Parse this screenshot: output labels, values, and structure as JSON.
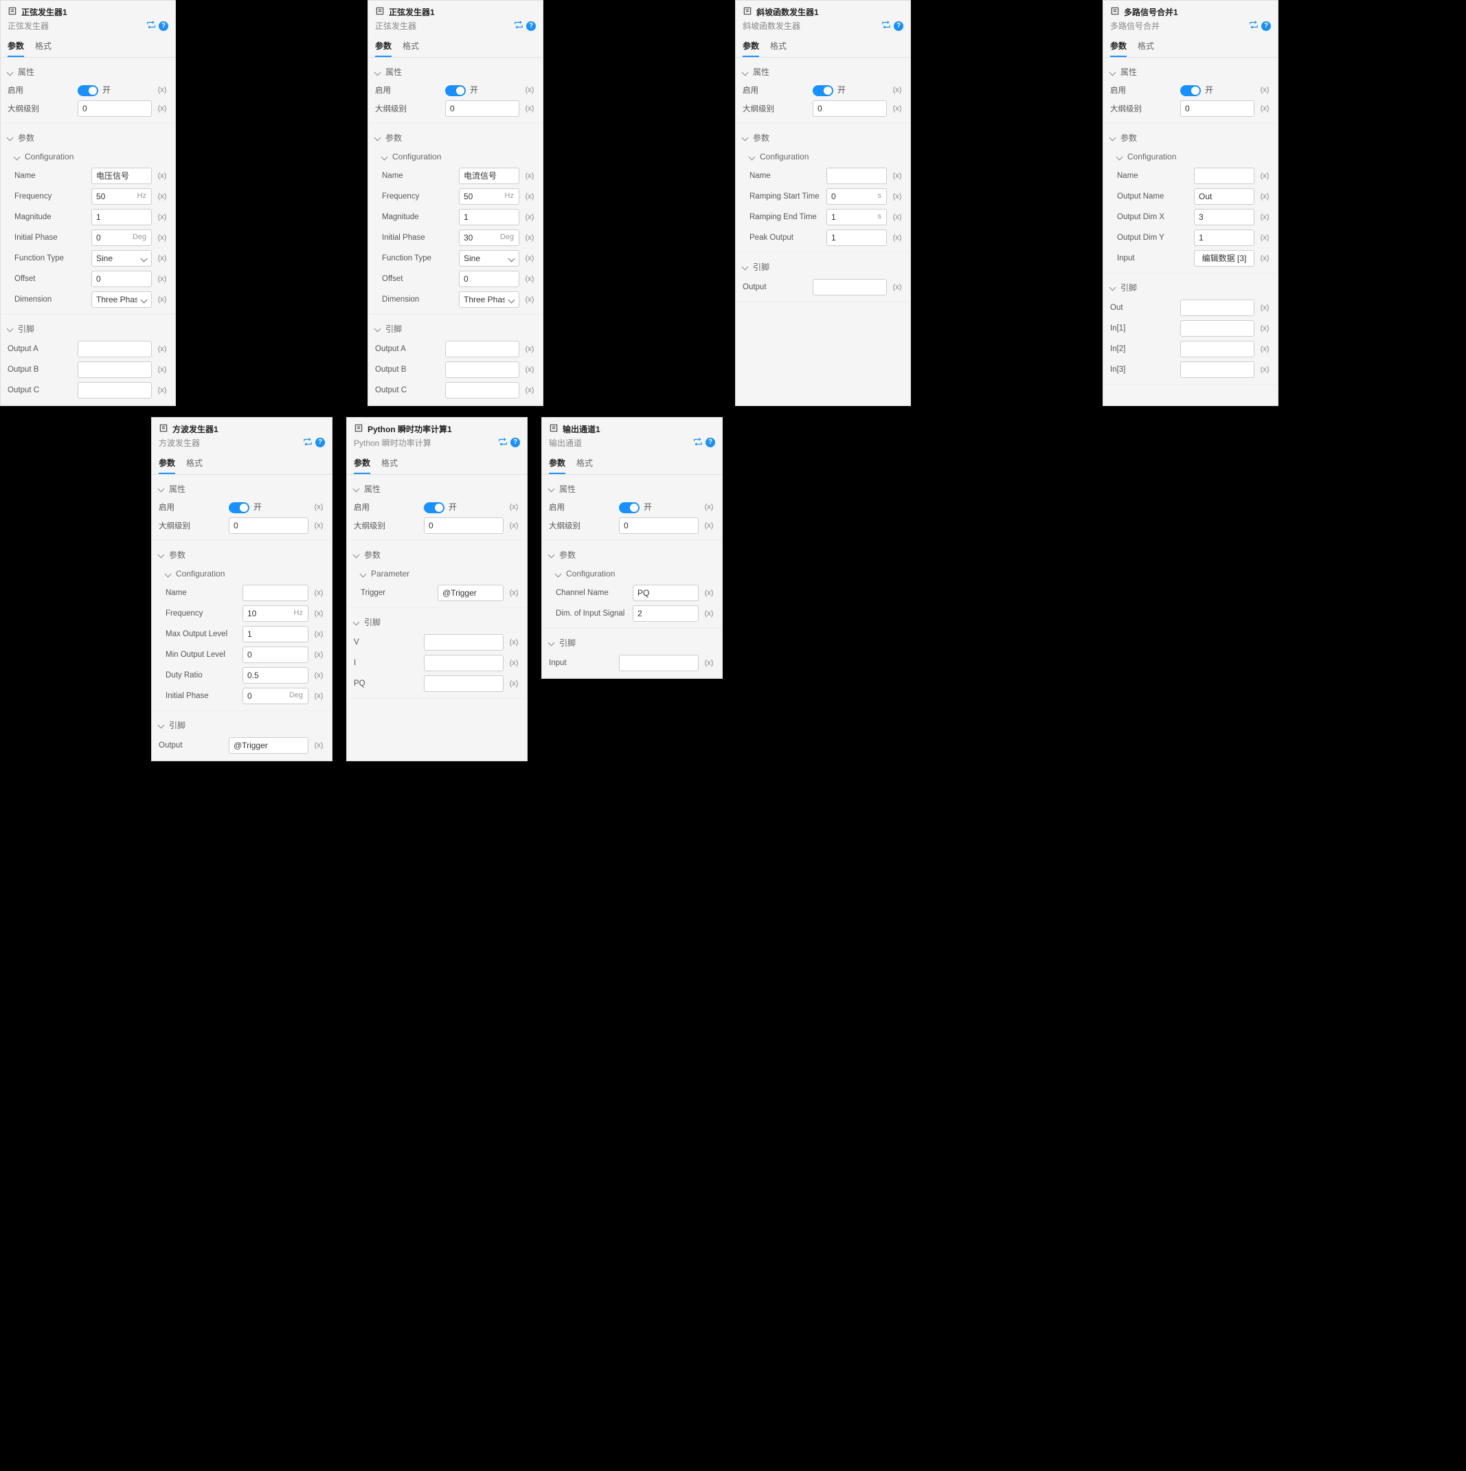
{
  "common": {
    "tab_params": "参数",
    "tab_format": "格式",
    "sec_attr": "属性",
    "sec_params": "参数",
    "sec_config": "Configuration",
    "sec_pins": "引脚",
    "enable": "启用",
    "on": "开",
    "outline": "大纲级别",
    "x": "(x)",
    "outline_val": "0",
    "sec_parameter": "Parameter"
  },
  "p1": {
    "title": "正弦发生器1",
    "sub": "正弦发生器",
    "name_l": "Name",
    "name_v": "电压信号",
    "freq_l": "Frequency",
    "freq_v": "50",
    "freq_u": "Hz",
    "mag_l": "Magnitude",
    "mag_v": "1",
    "ph_l": "Initial Phase",
    "ph_v": "0",
    "ph_u": "Deg",
    "ft_l": "Function Type",
    "ft_v": "Sine",
    "off_l": "Offset",
    "off_v": "0",
    "dim_l": "Dimension",
    "dim_v": "Three Phase",
    "outA": "Output A",
    "outB": "Output B",
    "outC": "Output C"
  },
  "p2": {
    "title": "正弦发生器1",
    "sub": "正弦发生器",
    "name_l": "Name",
    "name_v": "电流信号",
    "freq_l": "Frequency",
    "freq_v": "50",
    "freq_u": "Hz",
    "mag_l": "Magnitude",
    "mag_v": "1",
    "ph_l": "Initial Phase",
    "ph_v": "30",
    "ph_u": "Deg",
    "ft_l": "Function Type",
    "ft_v": "Sine",
    "off_l": "Offset",
    "off_v": "0",
    "dim_l": "Dimension",
    "dim_v": "Three Phase",
    "outA": "Output A",
    "outB": "Output B",
    "outC": "Output C"
  },
  "p3": {
    "title": "斜坡函数发生器1",
    "sub": "斜坡函数发生器",
    "name_l": "Name",
    "name_v": "",
    "st_l": "Ramping Start Time",
    "st_v": "0",
    "st_u": "s",
    "et_l": "Ramping End Time",
    "et_v": "1",
    "et_u": "s",
    "pk_l": "Peak Output",
    "pk_v": "1",
    "out": "Output"
  },
  "p4": {
    "title": "多路信号合并1",
    "sub": "多路信号合并",
    "name_l": "Name",
    "name_v": "",
    "on_l": "Output Name",
    "on_v": "Out",
    "dx_l": "Output Dim X",
    "dx_v": "3",
    "dy_l": "Output Dim Y",
    "dy_v": "1",
    "in_l": "Input",
    "in_btn": "编辑数据 [3]",
    "pout": "Out",
    "pin1": "In[1]",
    "pin2": "In[2]",
    "pin3": "In[3]"
  },
  "p5": {
    "title": "方波发生器1",
    "sub": "方波发生器",
    "name_l": "Name",
    "name_v": "",
    "freq_l": "Frequency",
    "freq_v": "10",
    "freq_u": "Hz",
    "max_l": "Max Output Level",
    "max_v": "1",
    "min_l": "Min Output Level",
    "min_v": "0",
    "duty_l": "Duty Ratio",
    "duty_v": "0.5",
    "ph_l": "Initial Phase",
    "ph_v": "0",
    "ph_u": "Deg",
    "out_l": "Output",
    "out_v": "@Trigger"
  },
  "p6": {
    "title": "Python 瞬时功率计算1",
    "sub": "Python 瞬时功率计算",
    "trg_l": "Trigger",
    "trg_v": "@Trigger",
    "pv": "V",
    "pi": "I",
    "ppq": "PQ"
  },
  "p7": {
    "title": "输出通道1",
    "sub": "输出通道",
    "cn_l": "Channel Name",
    "cn_v": "PQ",
    "dim_l": "Dim. of Input Signal",
    "dim_v": "2",
    "in_l": "Input"
  }
}
